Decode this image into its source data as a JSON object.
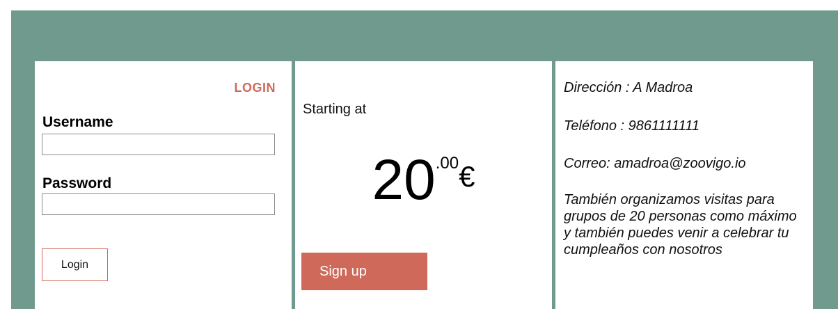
{
  "login": {
    "title": "LOGIN",
    "username_label": "Username",
    "username_value": "",
    "password_label": "Password",
    "password_value": "",
    "button_label": "Login"
  },
  "pricing": {
    "starting_text": "Starting at",
    "price_int": "20",
    "price_dec": ".00",
    "currency": "€",
    "signup_label": "Sign up"
  },
  "contact": {
    "address": "Dirección : A Madroa",
    "phone": "Teléfono : 9861111111",
    "email": "Correo: amadroa@zoovigo.io",
    "note": "También organizamos visitas para grupos de 20 personas como máximo y también puedes venir a celebrar tu cumpleaños con nosotros"
  },
  "colors": {
    "background": "#6f9a8d",
    "accent": "#cf6a5a",
    "panel": "#ffffff"
  }
}
